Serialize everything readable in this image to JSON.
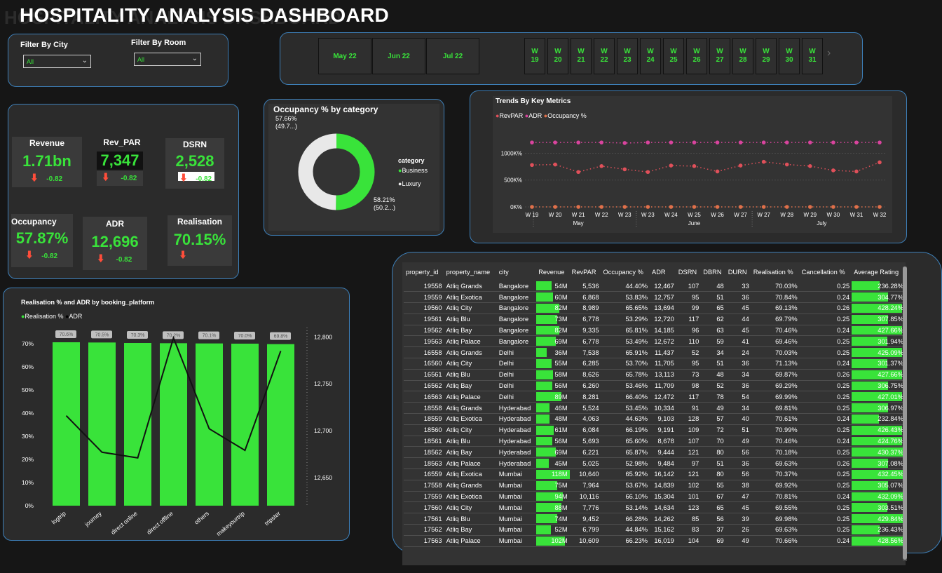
{
  "title": "HOSPITALITY ANALYSIS DASHBOARD",
  "filters": {
    "city_label": "Filter By City",
    "city_value": "All",
    "room_label": "Filter By Room",
    "room_value": "All"
  },
  "months": [
    "May 22",
    "Jun 22",
    "Jul 22"
  ],
  "weeks": [
    "19",
    "20",
    "21",
    "22",
    "23",
    "24",
    "25",
    "26",
    "27",
    "28",
    "29",
    "30",
    "31"
  ],
  "week_prefix": "W",
  "kpis": {
    "revenue": {
      "label": "Revenue",
      "value": "1.71bn",
      "delta": "-0.82"
    },
    "revpar": {
      "label": "Rev_PAR",
      "value": "7,347",
      "delta": "-0.82"
    },
    "dsrn": {
      "label": "DSRN",
      "value": "2,528",
      "delta": "-0.82"
    },
    "occupancy": {
      "label": "Occupancy",
      "value": "57.87%",
      "delta": "-0.82"
    },
    "adr": {
      "label": "ADR",
      "value": "12,696",
      "delta": "-0.82"
    },
    "realisation": {
      "label": "Realisation",
      "value": "70.15%"
    }
  },
  "donut": {
    "title": "Occupancy % by category",
    "legend_title": "category",
    "label_left": "57.66%",
    "label_left_sub": "(49.7...)",
    "label_right": "58.21%",
    "label_right_sub": "(50.2...)",
    "colors": {
      "business": "#39e33a",
      "luxury": "#e8e8e8"
    },
    "chart_data": {
      "type": "pie",
      "categories": [
        "Business",
        "Luxury"
      ],
      "values": [
        58.21,
        57.66
      ]
    }
  },
  "trends": {
    "title": "Trends By Key Metrics",
    "legend": [
      "RevPAR",
      "ADR",
      "Occupancy %"
    ],
    "colors": {
      "RevPAR": "#e0505a",
      "ADR": "#d9449e",
      "Occupancy %": "#e0704a"
    },
    "y_ticks": [
      "1000K%",
      "500K%",
      "0K%"
    ],
    "month_labels": [
      "May",
      "June",
      "July"
    ],
    "chart_data": {
      "type": "line",
      "x": [
        "W 19",
        "W 20",
        "W 21",
        "W 22",
        "W 23",
        "W 23",
        "W 24",
        "W 25",
        "W 26",
        "W 27",
        "W 27",
        "W 28",
        "W 29",
        "W 30",
        "W 31",
        "W 32"
      ],
      "ylim": [
        0,
        1450
      ],
      "series": [
        {
          "name": "RevPAR",
          "values": [
            780,
            790,
            650,
            760,
            700,
            650,
            770,
            760,
            660,
            770,
            840,
            790,
            760,
            680,
            660,
            830
          ]
        },
        {
          "name": "ADR",
          "values": [
            1200,
            1200,
            1200,
            1200,
            1190,
            1200,
            1200,
            1200,
            1200,
            1200,
            1200,
            1200,
            1200,
            1200,
            1200,
            1200
          ]
        },
        {
          "name": "Occupancy %",
          "values": [
            0,
            0,
            0,
            0,
            0,
            0,
            0,
            0,
            0,
            0,
            0,
            0,
            0,
            0,
            0,
            0
          ]
        }
      ]
    }
  },
  "platform": {
    "title": "Realisation % and ADR by booking_platform",
    "legend": [
      "Realisation %",
      "ADR"
    ],
    "left_ticks": [
      "70%",
      "60%",
      "50%",
      "40%",
      "30%",
      "20%",
      "10%",
      "0%"
    ],
    "right_ticks": [
      "12,800",
      "12,750",
      "12,700",
      "12,650"
    ],
    "data_labels": [
      "70.6%",
      "70.5%",
      "70.3%",
      "70.2%",
      "70.1%",
      "70.0%",
      "69.8%"
    ],
    "chart_data": {
      "type": "bar",
      "categories": [
        "logtrip",
        "journey",
        "direct online",
        "direct offline",
        "others",
        "makeyourtrip",
        "tripster"
      ],
      "series": [
        {
          "name": "Realisation %",
          "values": [
            70.6,
            70.5,
            70.3,
            70.2,
            70.1,
            70.0,
            69.8
          ]
        },
        {
          "name": "ADR",
          "values": [
            12716,
            12677,
            12671,
            12799,
            12702,
            12679,
            12785
          ]
        }
      ],
      "ylim": [
        0,
        75
      ],
      "y2lim": [
        12620,
        12810
      ]
    }
  },
  "table": {
    "headers": [
      "property_id",
      "property_name",
      "city",
      "Revenue",
      "RevPAR",
      "Occupancy %",
      "ADR",
      "DSRN",
      "DBRN",
      "DURN",
      "Realisation %",
      "Cancellation %",
      "Average Rating"
    ],
    "rows": [
      [
        "19558",
        "Atliq Grands",
        "Bangalore",
        "54M",
        "5,536",
        "44.40%",
        "12,467",
        "107",
        "48",
        "33",
        "70.03%",
        "0.25",
        "236.28%"
      ],
      [
        "19559",
        "Atliq Exotica",
        "Bangalore",
        "60M",
        "6,868",
        "53.83%",
        "12,757",
        "95",
        "51",
        "36",
        "70.84%",
        "0.24",
        "304.77%"
      ],
      [
        "19560",
        "Atliq City",
        "Bangalore",
        "82M",
        "8,989",
        "65.65%",
        "13,694",
        "99",
        "65",
        "45",
        "69.13%",
        "0.26",
        "428.24%"
      ],
      [
        "19561",
        "Atliq Blu",
        "Bangalore",
        "73M",
        "6,778",
        "53.29%",
        "12,720",
        "117",
        "62",
        "44",
        "69.79%",
        "0.25",
        "307.85%"
      ],
      [
        "19562",
        "Atliq Bay",
        "Bangalore",
        "82M",
        "9,335",
        "65.81%",
        "14,185",
        "96",
        "63",
        "45",
        "70.46%",
        "0.24",
        "427.66%"
      ],
      [
        "19563",
        "Atliq Palace",
        "Bangalore",
        "69M",
        "6,778",
        "53.49%",
        "12,672",
        "110",
        "59",
        "41",
        "69.46%",
        "0.25",
        "301.94%"
      ],
      [
        "16558",
        "Atliq Grands",
        "Delhi",
        "36M",
        "7,538",
        "65.91%",
        "11,437",
        "52",
        "34",
        "24",
        "70.03%",
        "0.25",
        "425.09%"
      ],
      [
        "16560",
        "Atliq City",
        "Delhi",
        "55M",
        "6,285",
        "53.70%",
        "11,705",
        "95",
        "51",
        "36",
        "71.13%",
        "0.24",
        "301.37%"
      ],
      [
        "16561",
        "Atliq Blu",
        "Delhi",
        "58M",
        "8,626",
        "65.78%",
        "13,113",
        "73",
        "48",
        "34",
        "69.87%",
        "0.26",
        "427.66%"
      ],
      [
        "16562",
        "Atliq Bay",
        "Delhi",
        "56M",
        "6,260",
        "53.46%",
        "11,709",
        "98",
        "52",
        "36",
        "69.29%",
        "0.25",
        "306.75%"
      ],
      [
        "16563",
        "Atliq Palace",
        "Delhi",
        "89M",
        "8,281",
        "66.40%",
        "12,472",
        "117",
        "78",
        "54",
        "69.99%",
        "0.25",
        "427.01%"
      ],
      [
        "18558",
        "Atliq Grands",
        "Hyderabad",
        "46M",
        "5,524",
        "53.45%",
        "10,334",
        "91",
        "49",
        "34",
        "69.81%",
        "0.25",
        "306.97%"
      ],
      [
        "18559",
        "Atliq Exotica",
        "Hyderabad",
        "48M",
        "4,063",
        "44.63%",
        "9,103",
        "128",
        "57",
        "40",
        "70.61%",
        "0.24",
        "232.84%"
      ],
      [
        "18560",
        "Atliq City",
        "Hyderabad",
        "61M",
        "6,084",
        "66.19%",
        "9,191",
        "109",
        "72",
        "51",
        "70.99%",
        "0.25",
        "426.43%"
      ],
      [
        "18561",
        "Atliq Blu",
        "Hyderabad",
        "56M",
        "5,693",
        "65.60%",
        "8,678",
        "107",
        "70",
        "49",
        "70.46%",
        "0.24",
        "424.76%"
      ],
      [
        "18562",
        "Atliq Bay",
        "Hyderabad",
        "69M",
        "6,221",
        "65.87%",
        "9,444",
        "121",
        "80",
        "56",
        "70.18%",
        "0.25",
        "430.37%"
      ],
      [
        "18563",
        "Atliq Palace",
        "Hyderabad",
        "45M",
        "5,025",
        "52.98%",
        "9,484",
        "97",
        "51",
        "36",
        "69.63%",
        "0.26",
        "307.08%"
      ],
      [
        "16559",
        "Atliq Exotica",
        "Mumbai",
        "118M",
        "10,640",
        "65.92%",
        "16,142",
        "121",
        "80",
        "56",
        "70.37%",
        "0.25",
        "432.45%"
      ],
      [
        "17558",
        "Atliq Grands",
        "Mumbai",
        "75M",
        "7,964",
        "53.67%",
        "14,839",
        "102",
        "55",
        "38",
        "69.92%",
        "0.25",
        "305.07%"
      ],
      [
        "17559",
        "Atliq Exotica",
        "Mumbai",
        "94M",
        "10,116",
        "66.10%",
        "15,304",
        "101",
        "67",
        "47",
        "70.81%",
        "0.24",
        "432.09%"
      ],
      [
        "17560",
        "Atliq City",
        "Mumbai",
        "88M",
        "7,776",
        "53.14%",
        "14,634",
        "123",
        "65",
        "45",
        "69.55%",
        "0.25",
        "303.51%"
      ],
      [
        "17561",
        "Atliq Blu",
        "Mumbai",
        "74M",
        "9,452",
        "66.28%",
        "14,262",
        "85",
        "56",
        "39",
        "69.98%",
        "0.25",
        "429.84%"
      ],
      [
        "17562",
        "Atliq Bay",
        "Mumbai",
        "52M",
        "6,799",
        "44.84%",
        "15,162",
        "83",
        "37",
        "26",
        "69.63%",
        "0.25",
        "236.43%"
      ],
      [
        "17563",
        "Atliq Palace",
        "Mumbai",
        "102M",
        "10,609",
        "66.23%",
        "16,019",
        "104",
        "69",
        "49",
        "70.66%",
        "0.24",
        "428.56%"
      ]
    ]
  }
}
